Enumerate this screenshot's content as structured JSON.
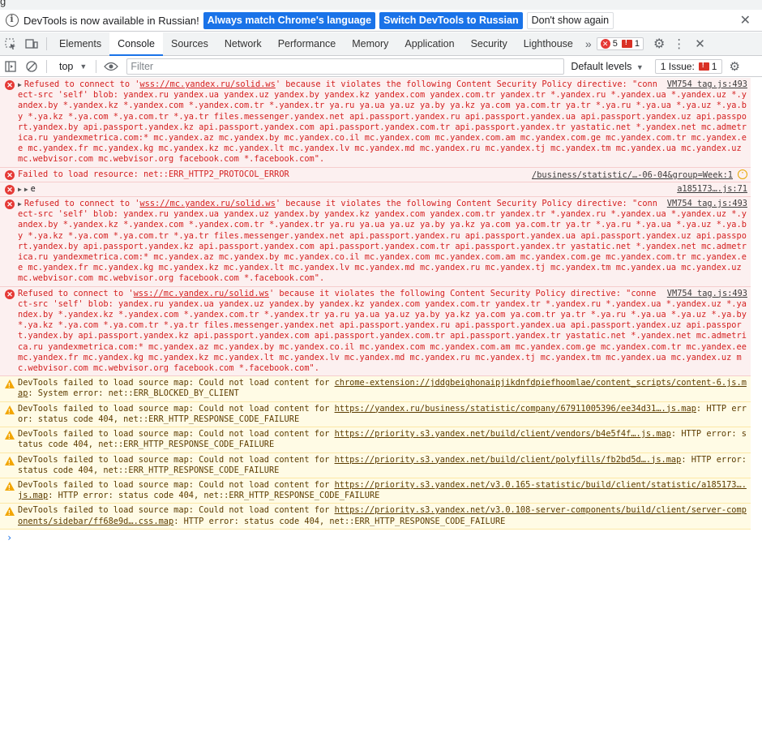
{
  "infobar": {
    "message": "DevTools is now available in Russian!",
    "match_btn": "Always match Chrome's language",
    "switch_btn": "Switch DevTools to Russian",
    "dismiss_btn": "Don't show again",
    "close": "✕"
  },
  "tabs": [
    "Elements",
    "Console",
    "Sources",
    "Network",
    "Performance",
    "Memory",
    "Application",
    "Security",
    "Lighthouse"
  ],
  "counts": {
    "errors": "5",
    "messages": "1"
  },
  "toolbar": {
    "context": "top",
    "filter_placeholder": "Filter",
    "levels": "Default levels",
    "issues_label": "1 Issue:",
    "issues_count": "1"
  },
  "messages": [
    {
      "level": "error",
      "source": "VM754 tag.js:493",
      "prefix": "Refused to connect to '",
      "link": "wss://mc.yandex.ru/solid.ws",
      "body": "' because it violates the following Content Security Policy directive: \"connect-src 'self' blob: yandex.ru yandex.ua yandex.uz yandex.by yandex.kz yandex.com yandex.com.tr yandex.tr *.yandex.ru *.yandex.ua *.yandex.uz *.yandex.by *.yandex.kz *.yandex.com *.yandex.com.tr *.yandex.tr ya.ru ya.ua ya.uz ya.by ya.kz ya.com ya.com.tr ya.tr *.ya.ru *.ya.ua *.ya.uz *.ya.by *.ya.kz *.ya.com *.ya.com.tr *.ya.tr files.messenger.yandex.net api.passport.yandex.ru api.passport.yandex.ua api.passport.yandex.uz api.passport.yandex.by api.passport.yandex.kz api.passport.yandex.com api.passport.yandex.com.tr api.passport.yandex.tr yastatic.net *.yandex.net mc.admetrica.ru yandexmetrica.com:* mc.yandex.az mc.yandex.by mc.yandex.co.il mc.yandex.com mc.yandex.com.am mc.yandex.com.ge mc.yandex.com.tr mc.yandex.ee mc.yandex.fr mc.yandex.kg mc.yandex.kz mc.yandex.lt mc.yandex.lv mc.yandex.md mc.yandex.ru mc.yandex.tj mc.yandex.tm mc.yandex.ua mc.yandex.uz mc.webvisor.com mc.webvisor.org facebook.com *.facebook.com\"."
    },
    {
      "level": "error",
      "source": "/business/statistic/…-06-04&group=Week:1",
      "text": "Failed to load resource: net::ERR_HTTP2_PROTOCOL_ERROR"
    },
    {
      "level": "error",
      "source": "a185173….js:71",
      "text": "e"
    },
    {
      "level": "error",
      "source": "VM754 tag.js:493",
      "prefix": "Refused to connect to '",
      "link": "wss://mc.yandex.ru/solid.ws",
      "body": "' because it violates the following Content Security Policy directive: \"connect-src 'self' blob: yandex.ru yandex.ua yandex.uz yandex.by yandex.kz yandex.com yandex.com.tr yandex.tr *.yandex.ru *.yandex.ua *.yandex.uz *.yandex.by *.yandex.kz *.yandex.com *.yandex.com.tr *.yandex.tr ya.ru ya.ua ya.uz ya.by ya.kz ya.com ya.com.tr ya.tr *.ya.ru *.ya.ua *.ya.uz *.ya.by *.ya.kz *.ya.com *.ya.com.tr *.ya.tr files.messenger.yandex.net api.passport.yandex.ru api.passport.yandex.ua api.passport.yandex.uz api.passport.yandex.by api.passport.yandex.kz api.passport.yandex.com api.passport.yandex.com.tr api.passport.yandex.tr yastatic.net *.yandex.net mc.admetrica.ru yandexmetrica.com:* mc.yandex.az mc.yandex.by mc.yandex.co.il mc.yandex.com mc.yandex.com.am mc.yandex.com.ge mc.yandex.com.tr mc.yandex.ee mc.yandex.fr mc.yandex.kg mc.yandex.kz mc.yandex.lt mc.yandex.lv mc.yandex.md mc.yandex.ru mc.yandex.tj mc.yandex.tm mc.yandex.ua mc.yandex.uz mc.webvisor.com mc.webvisor.org facebook.com *.facebook.com\"."
    },
    {
      "level": "error",
      "source": "VM754 tag.js:493",
      "prefix": "Refused to connect to '",
      "link": "wss://mc.yandex.ru/solid.ws",
      "body": "' because it violates the following Content Security Policy directive: \"connect-src 'self' blob: yandex.ru yandex.ua yandex.uz yandex.by yandex.kz yandex.com yandex.com.tr yandex.tr *.yandex.ru *.yandex.ua *.yandex.uz *.yandex.by *.yandex.kz *.yandex.com *.yandex.com.tr *.yandex.tr ya.ru ya.ua ya.uz ya.by ya.kz ya.com ya.com.tr ya.tr *.ya.ru *.ya.ua *.ya.uz *.ya.by *.ya.kz *.ya.com *.ya.com.tr *.ya.tr files.messenger.yandex.net api.passport.yandex.ru api.passport.yandex.ua api.passport.yandex.uz api.passport.yandex.by api.passport.yandex.kz api.passport.yandex.com api.passport.yandex.com.tr api.passport.yandex.tr yastatic.net *.yandex.net mc.admetrica.ru yandexmetrica.com:* mc.yandex.az mc.yandex.by mc.yandex.co.il mc.yandex.com mc.yandex.com.am mc.yandex.com.ge mc.yandex.com.tr mc.yandex.ee mc.yandex.fr mc.yandex.kg mc.yandex.kz mc.yandex.lt mc.yandex.lv mc.yandex.md mc.yandex.ru mc.yandex.tj mc.yandex.tm mc.yandex.ua mc.yandex.uz mc.webvisor.com mc.webvisor.org facebook.com *.facebook.com\"."
    },
    {
      "level": "warning",
      "prefix": "DevTools failed to load source map: Could not load content for ",
      "link": "chrome-extension://jddgbeighonaipjikdnfdpiefhoomlae/content_scripts/content-6.js.map",
      "body": ": System error: net::ERR_BLOCKED_BY_CLIENT"
    },
    {
      "level": "warning",
      "prefix": "DevTools failed to load source map: Could not load content for ",
      "link": "https://yandex.ru/business/statistic/company/67911005396/ee34d31….js.map",
      "body": ": HTTP error: status code 404, net::ERR_HTTP_RESPONSE_CODE_FAILURE"
    },
    {
      "level": "warning",
      "prefix": "DevTools failed to load source map: Could not load content for ",
      "link": "https://priority.s3.yandex.net/build/client/vendors/b4e5f4f….js.map",
      "body": ": HTTP error: status code 404, net::ERR_HTTP_RESPONSE_CODE_FAILURE"
    },
    {
      "level": "warning",
      "prefix": "DevTools failed to load source map: Could not load content for ",
      "link": "https://priority.s3.yandex.net/build/client/polyfills/fb2bd5d….js.map",
      "body": ": HTTP error: status code 404, net::ERR_HTTP_RESPONSE_CODE_FAILURE"
    },
    {
      "level": "warning",
      "prefix": "DevTools failed to load source map: Could not load content for ",
      "link": "https://priority.s3.yandex.net/v3.0.165-statistic/build/client/statistic/a185173….js.map",
      "body": ": HTTP error: status code 404, net::ERR_HTTP_RESPONSE_CODE_FAILURE"
    },
    {
      "level": "warning",
      "prefix": "DevTools failed to load source map: Could not load content for ",
      "link": "https://priority.s3.yandex.net/v3.0.108-server-components/build/client/server-components/sidebar/ff68e9d….css.map",
      "body": ": HTTP error: status code 404, net::ERR_HTTP_RESPONSE_CODE_FAILURE"
    }
  ],
  "prompt": "›"
}
